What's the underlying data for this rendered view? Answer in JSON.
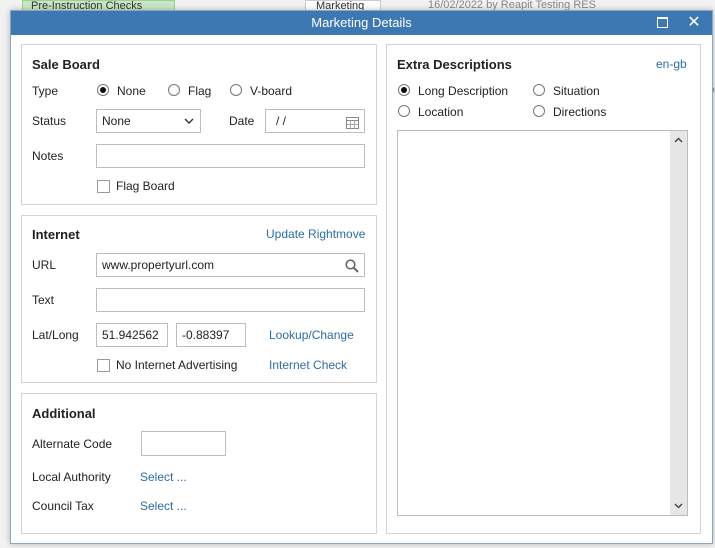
{
  "background": {
    "chip": "Pre-Instruction Checks",
    "tag": "Marketing",
    "line": "16/02/2022 by Reapit Testing RES",
    "edge1": "f",
    "edge2": "or",
    "edge3": "<"
  },
  "window": {
    "title": "Marketing Details",
    "maximize_label": "□",
    "close_label": "✕"
  },
  "sale_board": {
    "title": "Sale Board",
    "type_label": "Type",
    "type_options": [
      "None",
      "Flag",
      "V-board"
    ],
    "type_selected": "None",
    "status_label": "Status",
    "status_value": "None",
    "date_label": "Date",
    "date_value": "/ /",
    "notes_label": "Notes",
    "notes_value": "",
    "flag_board_label": "Flag Board",
    "flag_board_checked": false
  },
  "internet": {
    "title": "Internet",
    "update_link": "Update Rightmove",
    "url_label": "URL",
    "url_value": "www.propertyurl.com",
    "text_label": "Text",
    "text_value": "",
    "latlong_label": "Lat/Long",
    "lat_value": "51.942562",
    "long_value": "-0.88397",
    "lookup_link": "Lookup/Change",
    "no_advertising_label": "No Internet Advertising",
    "no_advertising_checked": false,
    "internet_check_link": "Internet Check"
  },
  "additional": {
    "title": "Additional",
    "alt_code_label": "Alternate Code",
    "alt_code_value": "",
    "local_authority_label": "Local Authority",
    "local_authority_link": "Select ...",
    "council_tax_label": "Council Tax",
    "council_tax_link": "Select ..."
  },
  "extra": {
    "title": "Extra Descriptions",
    "language_link": "en-gb",
    "options": [
      "Long Description",
      "Situation",
      "Location",
      "Directions"
    ],
    "selected": "Long Description",
    "text_value": "",
    "scroll_up": "^",
    "scroll_down": "v"
  },
  "colors": {
    "titlebar": "#3d78b3",
    "link": "#2e6da4",
    "panel_border": "#d4d4d4"
  }
}
